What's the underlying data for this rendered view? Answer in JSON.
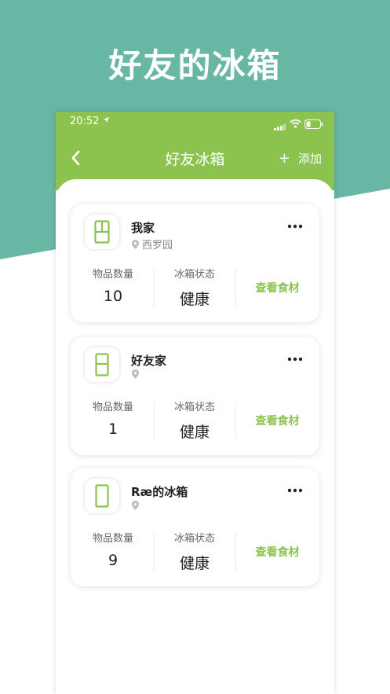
{
  "promo": {
    "title": "好友的冰箱"
  },
  "colors": {
    "teal": "#68b6a4",
    "green": "#8cc34e",
    "white": "#ffffff"
  },
  "status_bar": {
    "time": "20:52",
    "location_icon": "location-arrow-icon",
    "signal_icon": "signal-icon",
    "wifi_icon": "wifi-icon",
    "battery_icon": "battery-icon"
  },
  "nav": {
    "title": "好友冰箱",
    "add_label": "添加",
    "add_icon": "+"
  },
  "fridges": [
    {
      "name": "我家",
      "location": "西罗园",
      "count_label": "物品数量",
      "count": "10",
      "status_label": "冰箱状态",
      "status": "健康",
      "action": "查看食材",
      "icon": "double-door-fridge-icon"
    },
    {
      "name": "好友家",
      "location": "",
      "count_label": "物品数量",
      "count": "1",
      "status_label": "冰箱状态",
      "status": "健康",
      "action": "查看食材",
      "icon": "two-door-fridge-icon"
    },
    {
      "name": "Ræ的冰箱",
      "location": "",
      "count_label": "物品数量",
      "count": "9",
      "status_label": "冰箱状态",
      "status": "健康",
      "action": "查看食材",
      "icon": "single-door-fridge-icon"
    }
  ]
}
